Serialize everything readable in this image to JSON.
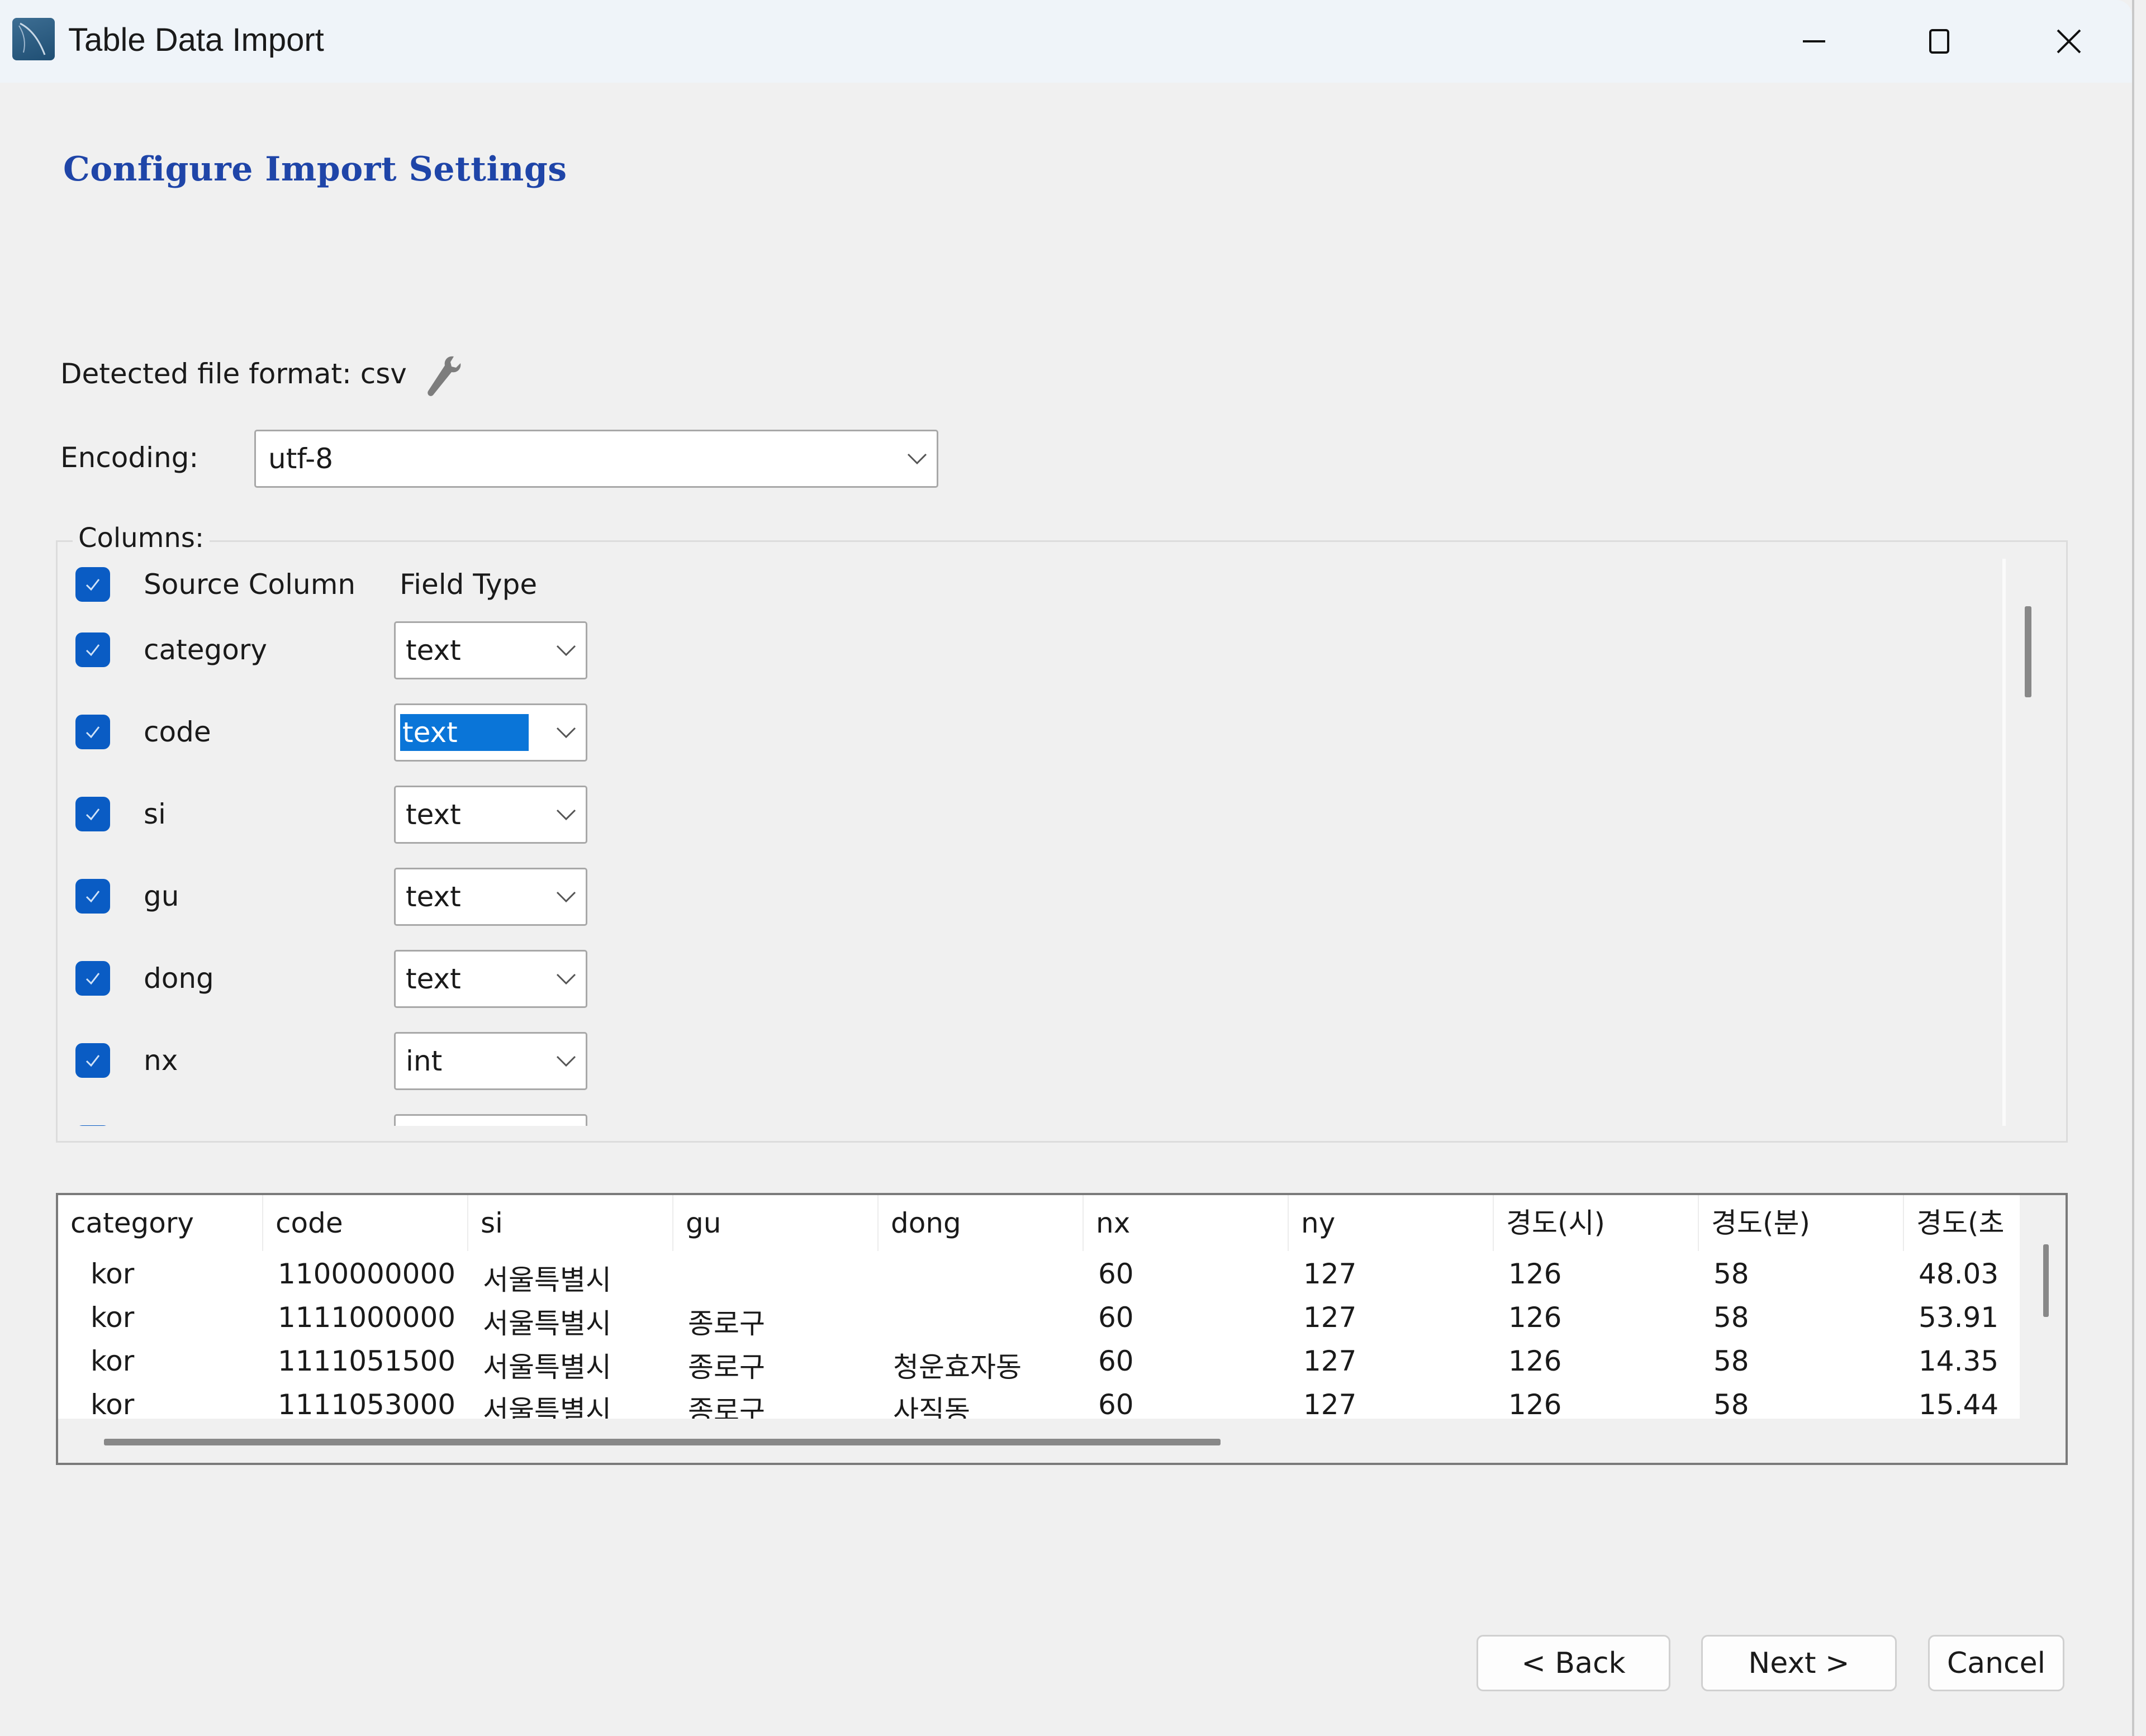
{
  "window": {
    "title": "Table Data Import",
    "controls": {
      "minimize": "minimize-icon",
      "maximize": "maximize-icon",
      "close": "close-icon"
    }
  },
  "page": {
    "heading": "Configure Import Settings",
    "detected_format_label": "Detected file format: csv",
    "encoding_label": "Encoding:",
    "encoding_value": "utf-8"
  },
  "columns": {
    "legend": "Columns:",
    "header": {
      "source": "Source Column",
      "field_type": "Field Type",
      "all_checked": true
    },
    "items": [
      {
        "name": "category",
        "type": "text",
        "checked": true,
        "selected": false
      },
      {
        "name": "code",
        "type": "text",
        "checked": true,
        "selected": true
      },
      {
        "name": "si",
        "type": "text",
        "checked": true,
        "selected": false
      },
      {
        "name": "gu",
        "type": "text",
        "checked": true,
        "selected": false
      },
      {
        "name": "dong",
        "type": "text",
        "checked": true,
        "selected": false
      },
      {
        "name": "nx",
        "type": "int",
        "checked": true,
        "selected": false
      }
    ]
  },
  "preview": {
    "headers": [
      "category",
      "code",
      "si",
      "gu",
      "dong",
      "nx",
      "ny",
      "경도(시)",
      "경도(분)",
      "경도(초"
    ],
    "rows": [
      [
        "kor",
        "1100000000",
        "서울특별시",
        "",
        "",
        "60",
        "127",
        "126",
        "58",
        "48.03"
      ],
      [
        "kor",
        "1111000000",
        "서울특별시",
        "종로구",
        "",
        "60",
        "127",
        "126",
        "58",
        "53.91"
      ],
      [
        "kor",
        "1111051500",
        "서울특별시",
        "종로구",
        "청운효자동",
        "60",
        "127",
        "126",
        "58",
        "14.35"
      ],
      [
        "kor",
        "1111053000",
        "서울특별시",
        "종로구",
        "사직동",
        "60",
        "127",
        "126",
        "58",
        "15.44"
      ]
    ]
  },
  "buttons": {
    "back": "< Back",
    "next": "Next >",
    "cancel": "Cancel"
  },
  "colors": {
    "accent": "#0a5cc4",
    "heading": "#1f45a8",
    "selection": "#0a75d8"
  }
}
